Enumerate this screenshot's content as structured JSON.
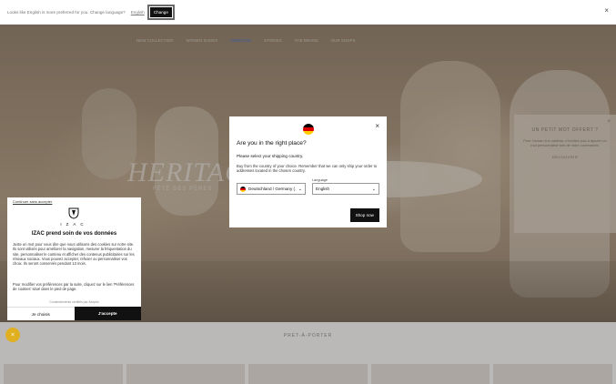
{
  "langbar": {
    "text": "Looks like English is more preferred for you. Change language?",
    "link": "English",
    "button": "Change"
  },
  "nav": [
    "NEW COLLECTION",
    "WOMEN SHOES",
    "HERITAGE",
    "STORIES",
    "THE BRAND",
    "OUR SHOPS"
  ],
  "hero": {
    "title": "HERITAGE",
    "subtitle": "FÊTE DES PÈRES"
  },
  "section_title": "PRET-À-PORTER",
  "promo": {
    "title": "UN PETIT MOT OFFERT ?",
    "body": "Pour l'achat d'un cadeau, n'hésitez pas à ajouter un mot personnalisé lors de votre commande.",
    "link": "DECOUVRIR"
  },
  "modal": {
    "title": "Are you in the right place?",
    "subtitle": "Please select your shipping country.",
    "description": "Buy from the country of your choice. Remember that we can only ship your order to addresses located in the chosen country.",
    "country_value": "Deutschland / Germany (…",
    "language_label": "Language",
    "language_value": "English",
    "submit": "Shop now"
  },
  "cookie": {
    "continue": "Continuer sans accepter",
    "brand": "IZAC",
    "title": "IZAC prend soin de vos données",
    "body1": "Juste un mot pour vous dire que nous utilisons des cookies sur notre site. Ils sont utilisés pour améliorer la navigation, mesurer la fréquentation du site, personnaliser le contenu et afficher des contenus publicitaires sur les réseaux sociaux. Vous pouvez accepter, refuser ou personnaliser vos choix. Ils seront conservés pendant 13 mois.",
    "body2": "Pour modifier vos préférences par la suite, cliquez sur le lien 'Préférences de cookies' situé dans le pied de page.",
    "powered": "Consentements certifiés par Axeptio",
    "choose": "Je choisis",
    "accept": "J'accepte"
  },
  "colors": {
    "accent": "#111111",
    "fab": "#e0b020",
    "nav_active": "#3a6fd8"
  }
}
